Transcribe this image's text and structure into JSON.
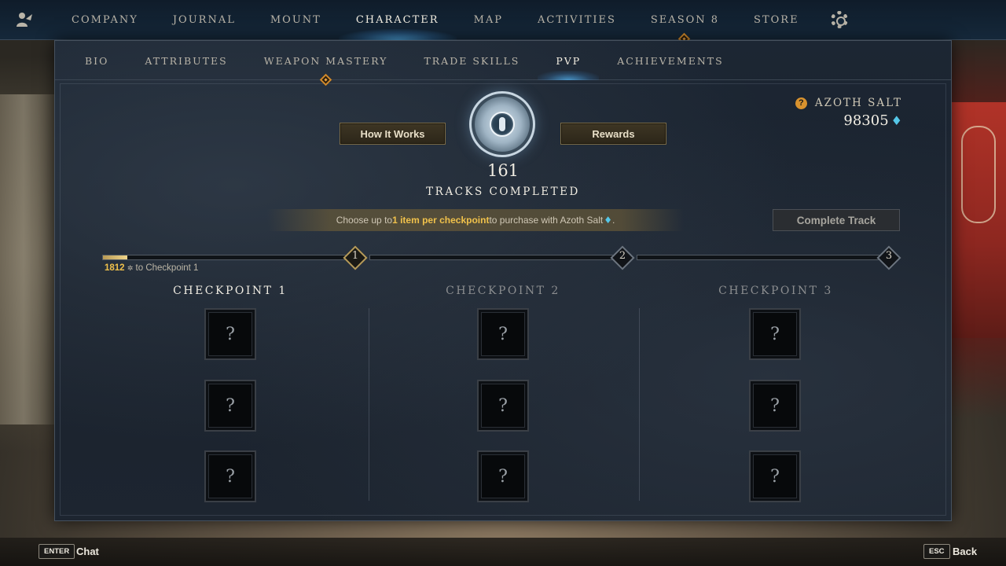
{
  "top_nav": {
    "items": [
      "COMPANY",
      "JOURNAL",
      "MOUNT",
      "CHARACTER",
      "MAP",
      "ACTIVITIES",
      "SEASON 8",
      "STORE"
    ],
    "active": "CHARACTER"
  },
  "sub_nav": {
    "items": [
      "BIO",
      "ATTRIBUTES",
      "WEAPON MASTERY",
      "TRADE SKILLS",
      "PVP",
      "ACHIEVEMENTS"
    ],
    "active": "PVP"
  },
  "header": {
    "how_it_works_label": "How It Works",
    "rewards_label": "Rewards",
    "tracks_completed_count": "161",
    "tracks_completed_label": "TRACKS COMPLETED"
  },
  "currency": {
    "name": "AZOTH SALT",
    "value": "98305",
    "icon": "azoth-salt-icon",
    "help_icon_glyph": "?"
  },
  "info": {
    "prefix": "Choose up to ",
    "highlight": "1 item per checkpoint",
    "suffix": " to purchase with Azoth Salt"
  },
  "complete_track_label": "Complete Track",
  "progress": {
    "points_needed": "1812",
    "points_suffix": " to Checkpoint 1",
    "fill_fraction": 0.1,
    "checkpoint_numbers": [
      "1",
      "2",
      "3"
    ]
  },
  "checkpoints": [
    {
      "title": "CHECKPOINT 1",
      "active": true,
      "slots": [
        "?",
        "?",
        "?"
      ]
    },
    {
      "title": "CHECKPOINT 2",
      "active": false,
      "slots": [
        "?",
        "?",
        "?"
      ]
    },
    {
      "title": "CHECKPOINT 3",
      "active": false,
      "slots": [
        "?",
        "?",
        "?"
      ]
    }
  ],
  "bottom_bar": {
    "chat_key": "ENTER",
    "chat_label": "Chat",
    "back_key": "ESC",
    "back_label": "Back"
  },
  "colors": {
    "accent_gold": "#f0c14b",
    "azoth_blue": "#55c7e8",
    "active_title": "#f0ece2",
    "inactive_title": "#8b8d8f"
  }
}
